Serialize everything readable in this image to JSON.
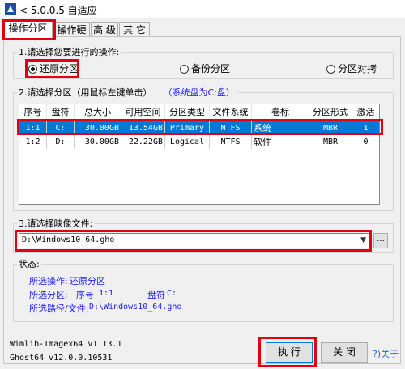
{
  "window": {
    "title": "< 5.0.0.5 自适应"
  },
  "tabs": [
    {
      "label": "操作分区",
      "active": true
    },
    {
      "label": "操作硬盘"
    },
    {
      "label": "高 级"
    },
    {
      "label": "其 它"
    }
  ],
  "operation": {
    "legend": "1.请选择您要进行的操作:",
    "options": [
      {
        "label": "还原分区",
        "selected": true
      },
      {
        "label": "备份分区",
        "selected": false
      },
      {
        "label": "分区对拷",
        "selected": false
      }
    ]
  },
  "partition": {
    "legend": "2.请选择分区（用鼠标左键单击）",
    "system_note": "（系统盘为C:盘）",
    "columns": [
      "序号",
      "盘符",
      "总大小",
      "可用空间",
      "分区类型",
      "文件系统",
      "卷标",
      "分区形式",
      "激活"
    ],
    "rows": [
      {
        "cells": [
          "1:1",
          "C:",
          "30.00GB",
          "13.54GB",
          "Primary",
          "NTFS",
          "系统",
          "MBR",
          "1"
        ],
        "selected": true
      },
      {
        "cells": [
          "1:2",
          "D:",
          "30.00GB",
          "22.22GB",
          "Logical",
          "NTFS",
          "软件",
          "MBR",
          "0"
        ],
        "selected": false
      }
    ]
  },
  "image": {
    "legend": "3.请选择映像文件:",
    "path": "D:\\Windows10_64.gho",
    "browse_label": "..."
  },
  "status": {
    "legend": "状态:",
    "op_label": "所选操作:",
    "op_value": "还原分区",
    "part_label": "所选分区:",
    "part_index_label": "序号",
    "part_index": "1:1",
    "drive_label": "盘符",
    "drive": "C:",
    "path_label": "所选路径/文件:",
    "path": "D:\\Windows10_64.gho"
  },
  "footer": {
    "wimlib": "Wimlib-Imagex64 v1.13.1",
    "ghost": "Ghost64 v12.0.0.10531",
    "run": "执 行",
    "close": "关 闭",
    "about": "?)关于"
  },
  "colors": {
    "highlight": "#e00010",
    "selection": "#0078d7",
    "status_text": "#1a1aff"
  }
}
